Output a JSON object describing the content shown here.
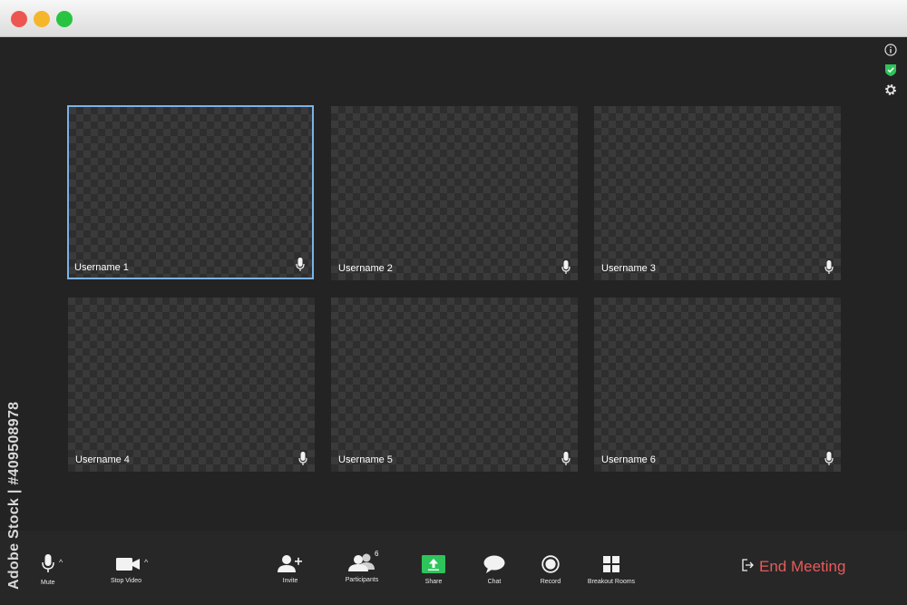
{
  "window": {
    "controls": [
      "close",
      "minimize",
      "zoom"
    ]
  },
  "status_icons": [
    "info-icon",
    "shield-check-icon",
    "gear-icon"
  ],
  "colors": {
    "active_border": "#7ab3e6",
    "share_green": "#2fc35b",
    "end_red": "#e85a5a"
  },
  "participants": [
    {
      "name": "Username 1",
      "active": true
    },
    {
      "name": "Username 2",
      "active": false
    },
    {
      "name": "Username 3",
      "active": false
    },
    {
      "name": "Username 4",
      "active": false
    },
    {
      "name": "Username 5",
      "active": false
    },
    {
      "name": "Username 6",
      "active": false
    }
  ],
  "toolbar": {
    "mute": "Mute",
    "stop_video": "Stop Video",
    "invite": "Invite",
    "participants": "Participants",
    "participants_count": "6",
    "share": "Share",
    "chat": "Chat",
    "record": "Record",
    "breakout_rooms": "Breakout Rooms",
    "end_meeting": "End Meeting"
  },
  "watermark_side": "Adobe Stock | #409508978"
}
